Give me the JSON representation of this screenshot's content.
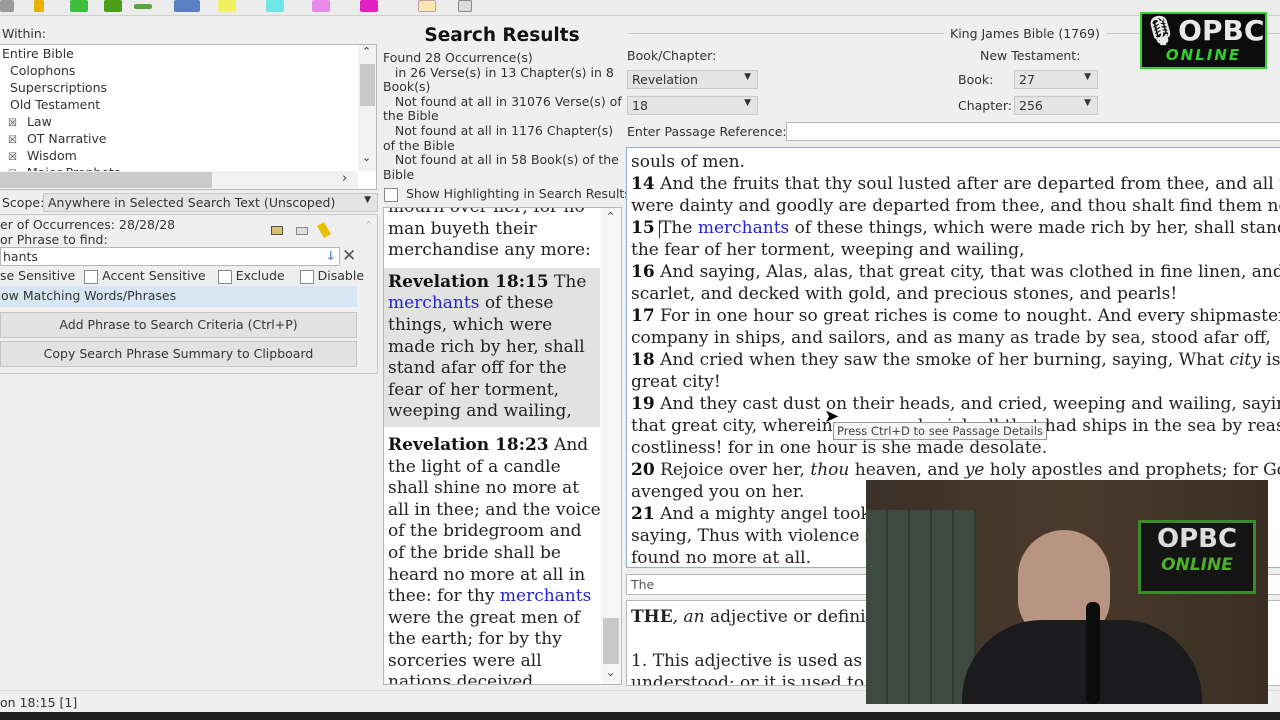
{
  "toolbar": {
    "icons": [
      "back-icon",
      "bookmark-icon",
      "green-arrow-icon",
      "green-book-icon",
      "forward-arrow-icon",
      "notes-icon",
      "highlighter-yellow-icon",
      "highlighter-cyan-icon",
      "highlighter-pink-icon",
      "highlighter-magenta-icon",
      "clipboard-icon",
      "window-icon"
    ]
  },
  "left": {
    "within_label": "Within:",
    "tree": [
      {
        "label": "Entire Bible",
        "check": false,
        "indent": 0
      },
      {
        "label": "Colophons",
        "check": false,
        "indent": 1
      },
      {
        "label": "Superscriptions",
        "check": false,
        "indent": 1
      },
      {
        "label": "Old Testament",
        "check": false,
        "indent": 1
      },
      {
        "label": "Law",
        "check": true,
        "indent": 2
      },
      {
        "label": "OT Narrative",
        "check": true,
        "indent": 2
      },
      {
        "label": "Wisdom",
        "check": true,
        "indent": 2
      },
      {
        "label": "Major Prophets",
        "check": true,
        "indent": 2
      }
    ],
    "scope_label": "Scope:",
    "scope_value": "Anywhere in Selected Search Text (Unscoped)",
    "occurrences": "er of Occurrences: 28/28/28",
    "phrase_label": "or Phrase to find:",
    "phrase_value": "hants",
    "options": [
      "se Sensitive",
      "Accent Sensitive",
      "Exclude",
      "Disable"
    ],
    "show_matching": "ow Matching Words/Phrases",
    "add_phrase_button": "Add Phrase to Search Criteria (Ctrl+P)",
    "copy_summary_button": "Copy Search Phrase Summary to Clipboard"
  },
  "results": {
    "title": "Search Results",
    "summary": [
      "Found 28 Occurrence(s)",
      "   in 26 Verse(s) in 13 Chapter(s) in 8",
      "Book(s)",
      "   Not found at all in 31076 Verse(s) of",
      "the Bible",
      "   Not found at all in 1176 Chapter(s)",
      "of the Bible",
      "   Not found at all in 58 Book(s) of the",
      "Bible"
    ],
    "highlight_label": "Show Highlighting in Search Results",
    "top_partial": [
      "mourn over her; for no",
      "man buyeth their",
      "merchandise any more:"
    ],
    "entries": [
      {
        "ref": "Revelation 18:15",
        "lines": [
          [
            " The"
          ],
          [
            "merchants|b",
            " of these"
          ],
          [
            "things, which were"
          ],
          [
            "made rich by her, shall"
          ],
          [
            "stand afar off for the"
          ],
          [
            "fear of her torment,"
          ],
          [
            "weeping and wailing,"
          ]
        ],
        "selected": true
      },
      {
        "ref": "Revelation 18:23",
        "lines": [
          [
            " And"
          ],
          [
            "the light of a candle"
          ],
          [
            "shall shine no more at"
          ],
          [
            "all in thee; and the voice"
          ],
          [
            "of the bridegroom and"
          ],
          [
            "of the bride shall be"
          ],
          [
            "heard no more at all in"
          ],
          [
            "thee: for thy ",
            "merchants|b"
          ],
          [
            "were the great men of"
          ],
          [
            "the earth; for by thy"
          ],
          [
            "sorceries were all"
          ],
          [
            "nations deceived."
          ]
        ],
        "selected": false
      }
    ]
  },
  "reader": {
    "bible": "King James Bible (1769)",
    "book_chapter_label": "Book/Chapter:",
    "book": "Revelation",
    "chapter": "18",
    "testament": "New Testament:",
    "book_num_label": "Book:",
    "book_num": "27",
    "chapter_num_label": "Chapter:",
    "chapter_num": "256",
    "passage_label": "Enter Passage Reference:",
    "passage_value": "",
    "lines": [
      [
        null,
        "souls of men."
      ],
      [
        "14",
        " And the fruits that thy soul lusted after are departed from thee, and all th"
      ],
      [
        null,
        "were dainty and goodly are departed from thee, and thou shalt find them no"
      ],
      [
        "15",
        " The ",
        "merchants|b",
        " of these things, which were made rich by her, shall stand"
      ],
      [
        null,
        "the fear of her torment, weeping and wailing,"
      ],
      [
        "16",
        " And saying, Alas, alas, that great city, that was clothed in fine linen, and"
      ],
      [
        null,
        "scarlet, and decked with gold, and precious stones, and pearls!"
      ],
      [
        "17",
        " For in one hour so great riches is come to nought. And every shipmaster,"
      ],
      [
        null,
        "company in ships, and sailors, and as many as trade by sea, stood afar off,"
      ],
      [
        "18",
        " And cried when they saw the smoke of her burning, saying, What ",
        "city|i",
        " is l"
      ],
      [
        null,
        "great city!"
      ],
      [
        "19",
        " And they cast dust on their heads, and cried, weeping and wailing, saying"
      ],
      [
        null,
        "that great city, wherein were made rich all that had ships in the sea by reaso"
      ],
      [
        null,
        "costliness! for in one hour is she made desolate."
      ],
      [
        "20",
        " Rejoice over her, ",
        "thou|i",
        " heaven, and ",
        "ye|i",
        " holy apostles and prophets; for Goc"
      ],
      [
        null,
        "avenged you on her."
      ],
      [
        "21",
        " And a mighty angel took"
      ],
      [
        null,
        "saying, Thus with violence s"
      ],
      [
        null,
        "found no more at all."
      ]
    ],
    "tooltip": "Press Ctrl+D to see Passage Details",
    "dict_word": "The",
    "dict_head": "THE",
    "dict_head_rest": ", ",
    "dict_an": "an",
    "dict_line1": " adjective or definit",
    "dict_line2": "1. This adjective is used as a",
    "dict_line3": "understood; or it is used to"
  },
  "status": "on 18:15 [1]",
  "overlay": {
    "logo_text": "OPBC",
    "logo_sub": "ONLINE",
    "accent": "#2fd12f"
  }
}
